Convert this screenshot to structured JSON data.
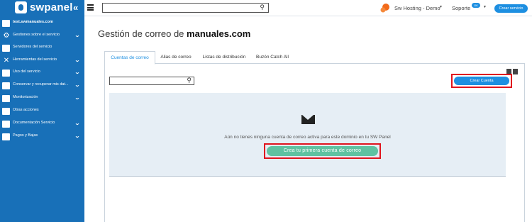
{
  "brand": {
    "name": "swpanel"
  },
  "topbar": {
    "search_placeholder": "",
    "account_name": "Sw Hosting - Demo",
    "support_label": "Soporte",
    "support_badge": "OK",
    "create_service_label": "Crear servicio"
  },
  "sidebar": {
    "items": [
      {
        "label": "test.swmanuales.com",
        "icon": "server-icon",
        "has_chevron": false
      },
      {
        "label": "Gestiones sobre el servicio",
        "icon": "gears-icon",
        "has_chevron": true
      },
      {
        "label": "Servidores del servicio",
        "icon": "server-stack-icon",
        "has_chevron": false
      },
      {
        "label": "Herramientas del servicio",
        "icon": "tools-icon",
        "has_chevron": true
      },
      {
        "label": "Uso del servicio",
        "icon": "usage-icon",
        "has_chevron": true
      },
      {
        "label": "Conservar y recuperar mis dat...",
        "icon": "backup-icon",
        "has_chevron": true
      },
      {
        "label": "Monitorización",
        "icon": "monitor-icon",
        "has_chevron": true
      },
      {
        "label": "Otras acciones",
        "icon": "clipboard-icon",
        "has_chevron": false
      },
      {
        "label": "Documentación Servicio",
        "icon": "document-icon",
        "has_chevron": true
      },
      {
        "label": "Pagos y Bajas",
        "icon": "payments-icon",
        "has_chevron": true
      }
    ]
  },
  "page": {
    "title_prefix": "Gestión de correo de",
    "title_domain": "manuales.com"
  },
  "tabs": [
    {
      "label": "Cuentas de correo",
      "active": true
    },
    {
      "label": "Alias de correo",
      "active": false
    },
    {
      "label": "Listas de distribución",
      "active": false
    },
    {
      "label": "Buzón Catch All",
      "active": false
    }
  ],
  "content": {
    "search_placeholder": "",
    "create_account_label": "Crear Cuenta",
    "empty_message": "Aún no tienes ninguna cuenta de correo activa para este dominio en tu SW Panel",
    "create_first_label": "Crea tu primera cuenta de correo"
  },
  "colors": {
    "sidebar": "#1870b8",
    "accent": "#1d8fe1",
    "success": "#5fc2a1",
    "highlight": "#e0141e"
  }
}
